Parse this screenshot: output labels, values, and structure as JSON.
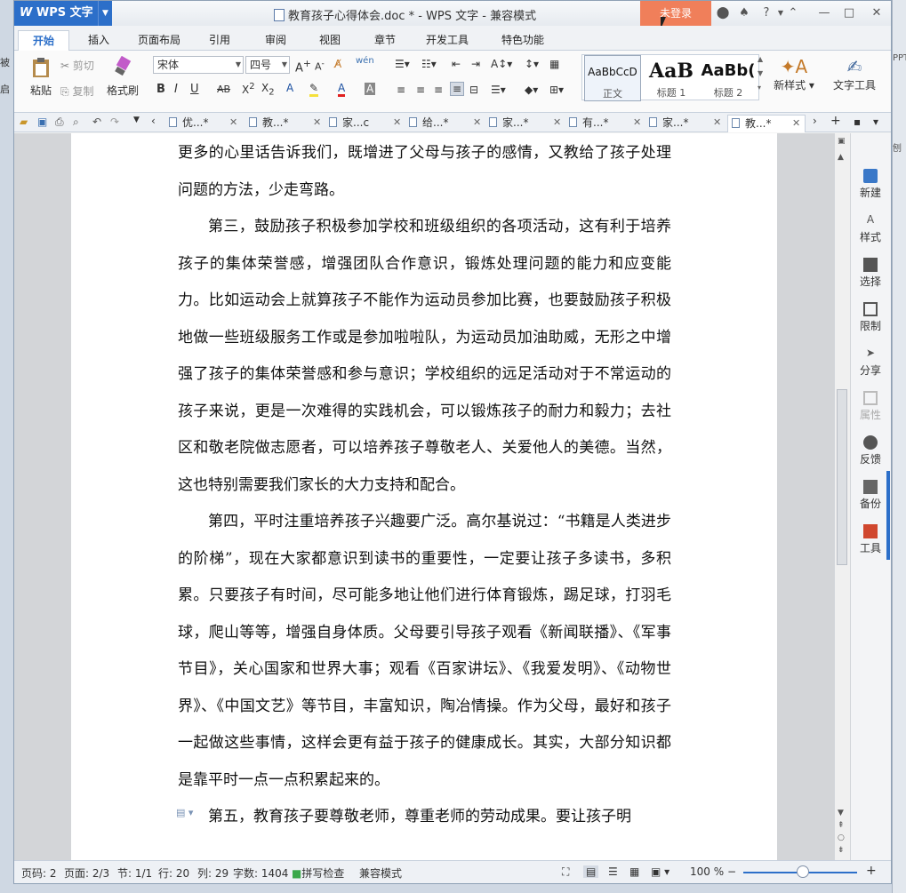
{
  "desktop": {
    "left_labels": [
      "被",
      "启"
    ],
    "right_labels": [
      "PPT",
      "刨"
    ]
  },
  "window": {
    "app_name": "WPS 文字",
    "doc_title": "教育孩子心得体会.doc * - WPS 文字 - 兼容模式",
    "login_button": "未登录",
    "help": "?",
    "controls": [
      "—",
      "□",
      "✕"
    ]
  },
  "menu": {
    "tabs": [
      "开始",
      "插入",
      "页面布局",
      "引用",
      "审阅",
      "视图",
      "章节",
      "开发工具",
      "特色功能"
    ],
    "active_tab": "开始"
  },
  "ribbon": {
    "paste": "粘贴",
    "cut": "剪切",
    "copy": "复制",
    "format_painter": "格式刷",
    "font_name": "宋体",
    "font_size": "四号",
    "styles": [
      {
        "preview": "AaBbCcD",
        "label": "正文"
      },
      {
        "preview": "AaB",
        "label": "标题 1"
      },
      {
        "preview": "AaBb(",
        "label": "标题 2"
      }
    ],
    "new_style": "新样式",
    "text_tools": "文字工具"
  },
  "doc_tabs": [
    "优...*",
    "教...*",
    "家...c",
    "给...*",
    "家...*",
    "有...*",
    "家...*",
    "教...*"
  ],
  "active_doc_tab": 7,
  "document": {
    "paragraphs": [
      {
        "indent": false,
        "text": "更多的心里话告诉我们，既增进了父母与孩子的感情，又教给了孩子处理问题的方法，少走弯路。"
      },
      {
        "indent": true,
        "text": "第三，鼓励孩子积极参加学校和班级组织的各项活动，这有利于培养孩子的集体荣誉感，增强团队合作意识，锻炼处理问题的能力和应变能力。比如运动会上就算孩子不能作为运动员参加比赛，也要鼓励孩子积极地做一些班级服务工作或是参加啦啦队，为运动员加油助威，无形之中增强了孩子的集体荣誉感和参与意识；学校组织的远足活动对于不常运动的孩子来说，更是一次难得的实践机会，可以锻炼孩子的耐力和毅力；去社区和敬老院做志愿者，可以培养孩子尊敬老人、关爱他人的美德。当然，这也特别需要我们家长的大力支持和配合。"
      },
      {
        "indent": true,
        "text": "第四，平时注重培养孩子兴趣要广泛。高尔基说过：“书籍是人类进步的阶梯”，现在大家都意识到读书的重要性，一定要让孩子多读书，多积累。只要孩子有时间，尽可能多地让他们进行体育锻炼，踢足球，打羽毛球，爬山等等，增强自身体质。父母要引导孩子观看《新闻联播》、《军事节目》，关心国家和世界大事；观看《百家讲坛》、《我爱发明》、《动物世界》、《中国文艺》等节目，丰富知识，陶冶情操。作为父母，最好和孩子一起做这些事情，这样会更有益于孩子的健康成长。其实，大部分知识都是靠平时一点一点积累起来的。"
      },
      {
        "indent": true,
        "text": "第五，教育孩子要尊敬老师，尊重老师的劳动成果。要让孩子明"
      }
    ]
  },
  "sidebar": {
    "items": [
      {
        "label": "新建",
        "icon": "new-doc-icon",
        "enabled": true
      },
      {
        "label": "样式",
        "icon": "style-icon",
        "enabled": true
      },
      {
        "label": "选择",
        "icon": "select-icon",
        "enabled": true
      },
      {
        "label": "限制",
        "icon": "restrict-icon",
        "enabled": true
      },
      {
        "label": "分享",
        "icon": "share-icon",
        "enabled": true
      },
      {
        "label": "属性",
        "icon": "properties-icon",
        "enabled": false
      },
      {
        "label": "反馈",
        "icon": "feedback-icon",
        "enabled": true
      },
      {
        "label": "备份",
        "icon": "backup-icon",
        "enabled": true
      },
      {
        "label": "工具",
        "icon": "toolbox-icon",
        "enabled": true
      }
    ]
  },
  "status": {
    "page_code": "页码: 2",
    "pages": "页面: 2/3",
    "section": "节: 1/1",
    "row": "行: 20",
    "col": "列: 29",
    "words": "字数: 1404",
    "spell": "拼写检查",
    "compat": "兼容模式",
    "zoom": "100 %",
    "zoom_level": 1.0
  },
  "colors": {
    "accent": "#2c6fc9",
    "login": "#f07f5a"
  }
}
